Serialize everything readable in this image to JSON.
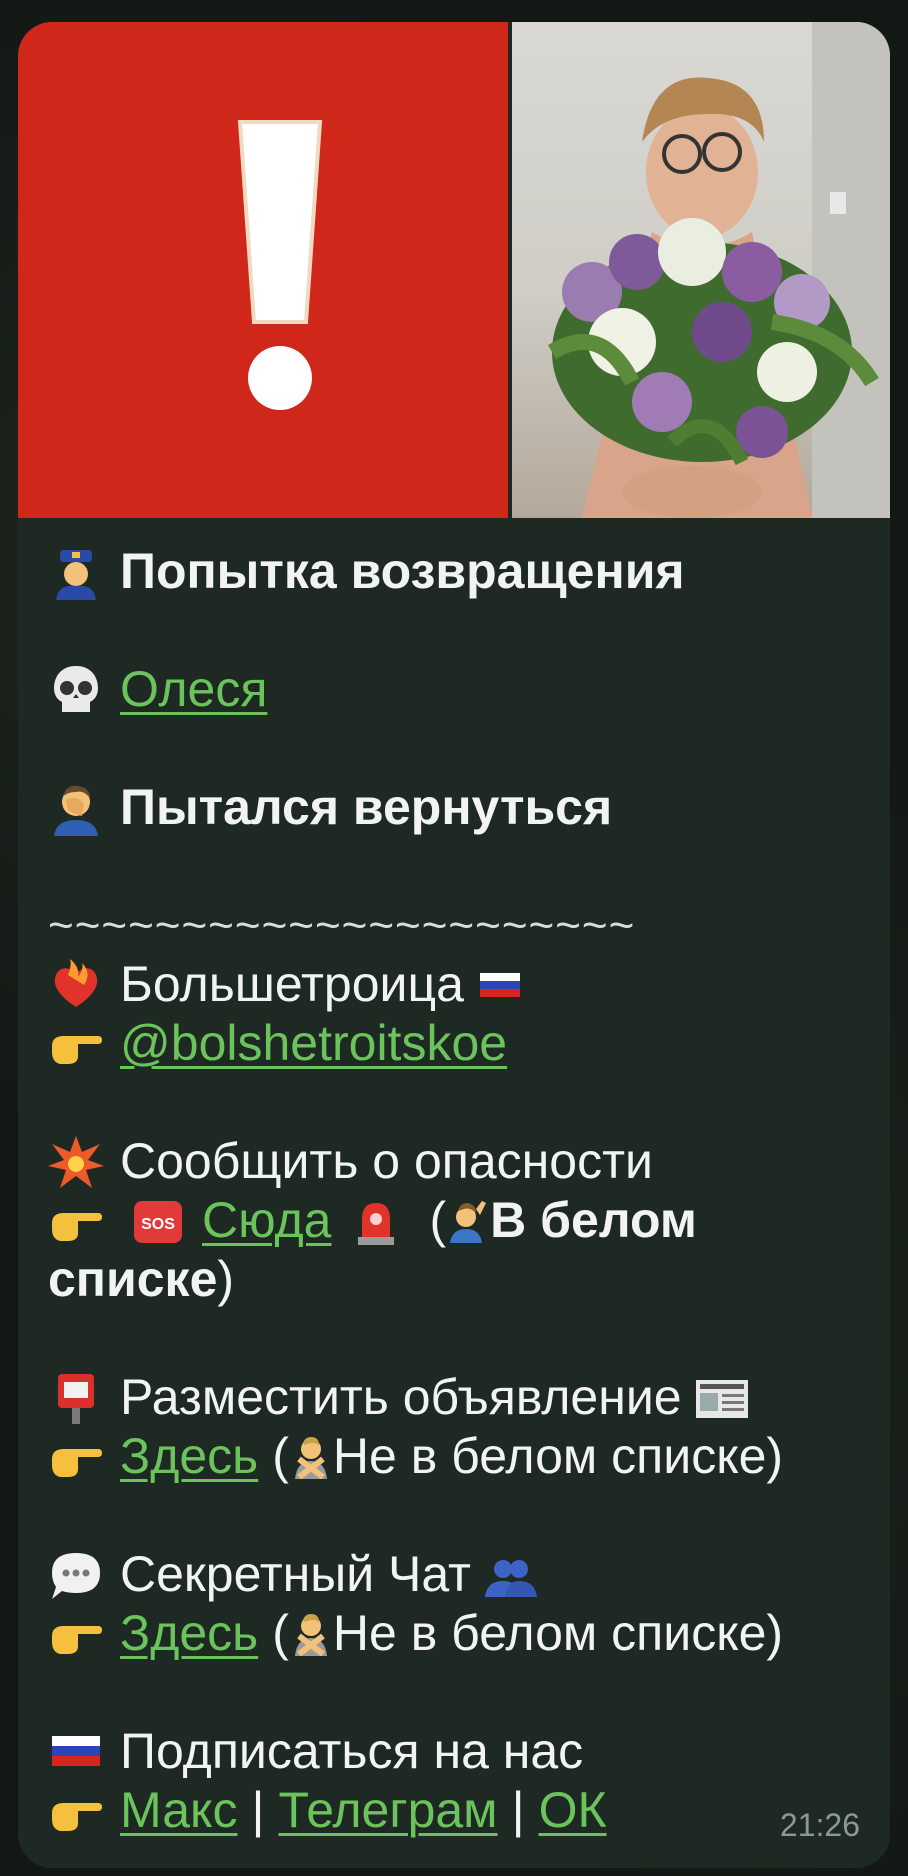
{
  "message": {
    "title": "Попытка возвращения",
    "name": "Олеся",
    "status": "Пытался вернуться",
    "divider": "~~~~~~~~~~~~~~~~~~~~~~",
    "community_name": "Большетроица",
    "community_handle": "@bolshetroitskoe",
    "report_label": "Сообщить о опасности",
    "report_link": "Сюда",
    "report_open_paren": "(",
    "whitelist_label": "В белом",
    "whitelist_label_2": "списке",
    "whitelist_close": ")",
    "ad_label": "Разместить объявление",
    "ad_link": "Здесь",
    "ad_note_open": "(",
    "ad_note": "Не в белом списке)",
    "chat_label": "Секретный Чат",
    "chat_link": "Здесь",
    "chat_note_open": "(",
    "chat_note": "Не в белом списке)",
    "subscribe_label": "Подписаться на нас",
    "sub_link_1": "Макс",
    "sub_sep_1": "|",
    "sub_link_2": "Телеграм",
    "sub_sep_2": "|",
    "sub_link_3": "ОК",
    "time": "21:26"
  },
  "icons": [
    "police-officer-icon",
    "skull-icon",
    "facepalm-icon",
    "heart-on-fire-icon",
    "russia-flag-icon",
    "pointing-hand-icon",
    "collision-icon",
    "sos-icon",
    "siren-icon",
    "raising-hand-icon",
    "postbox-icon",
    "newspaper-icon",
    "no-gesture-icon",
    "speech-bubble-icon",
    "people-icon"
  ],
  "colors": {
    "alert_red": "#d0271b",
    "link_green": "#6bc35b",
    "bubble_bg": "#1f2924"
  }
}
